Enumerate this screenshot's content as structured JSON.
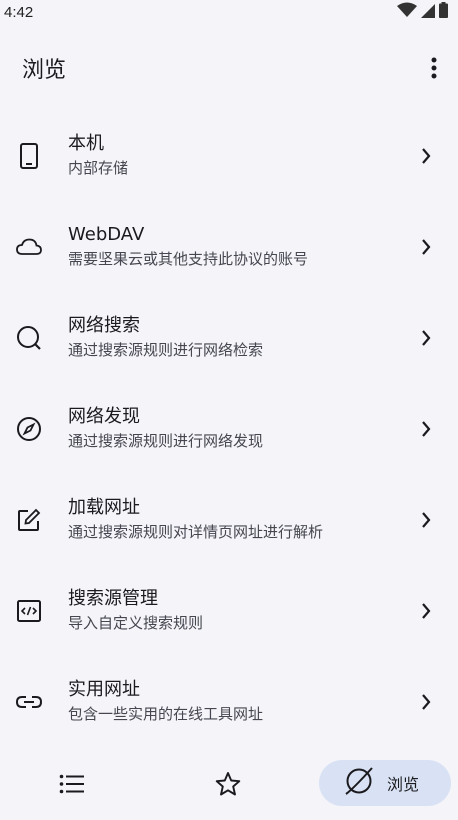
{
  "status_bar": {
    "time": "4:42"
  },
  "app_bar": {
    "title": "浏览"
  },
  "items": [
    {
      "icon": "phone-icon",
      "title": "本机",
      "subtitle": "内部存储"
    },
    {
      "icon": "cloud-icon",
      "title": "WebDAV",
      "subtitle": "需要坚果云或其他支持此协议的账号"
    },
    {
      "icon": "search-icon",
      "title": "网络搜索",
      "subtitle": "通过搜索源规则进行网络检索"
    },
    {
      "icon": "compass-icon",
      "title": "网络发现",
      "subtitle": "通过搜索源规则进行网络发现"
    },
    {
      "icon": "edit-icon",
      "title": "加载网址",
      "subtitle": "通过搜索源规则对详情页网址进行解析"
    },
    {
      "icon": "code-icon",
      "title": "搜索源管理",
      "subtitle": "导入自定义搜索规则"
    },
    {
      "icon": "link-icon",
      "title": "实用网址",
      "subtitle": "包含一些实用的在线工具网址"
    }
  ],
  "bottom_nav": {
    "list_icon": "list-icon",
    "favorite_icon": "star-icon",
    "browse_icon": "compass-icon",
    "browse_label": "浏览"
  },
  "colors": {
    "background": "#f4f4f9",
    "active_nav_pill": "#d9e2f4",
    "text_primary": "#1b1b1f",
    "text_secondary": "#45464f"
  }
}
